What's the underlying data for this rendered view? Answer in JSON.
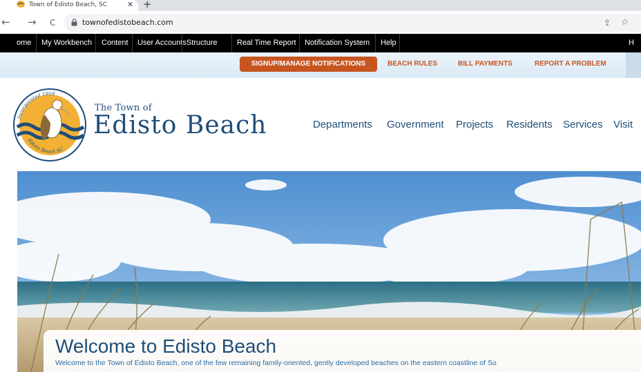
{
  "browser": {
    "tab_title": "Town of Edisto Beach, SC",
    "tab_close": "✕",
    "new_tab": "+",
    "url": "townofedistobeach.com",
    "nav": {
      "back": "←",
      "forward": "→",
      "reload": "C"
    },
    "icons": {
      "share": "⇪",
      "star": "☆"
    }
  },
  "admin_bar": {
    "items": [
      "ome",
      "My Workbench",
      "Content",
      "User Accounts",
      "Structure",
      "Real Time Report",
      "Notification System",
      "Help"
    ],
    "right_item": "H"
  },
  "utility_nav": {
    "signup": "SIGNUP/MANAGE NOTIFICATIONS",
    "links": [
      "BEACH RULES",
      "BILL PAYMENTS",
      "REPORT A PROBLEM"
    ],
    "accent_color": "#c75520"
  },
  "brand": {
    "line1": "The Town of",
    "line2": "Edisto Beach",
    "logo_ring_top": "Incorporated 1959",
    "logo_ring_bottom": "Edisto Beach SC",
    "color": "#1f4e79"
  },
  "main_nav": {
    "items": [
      "Departments",
      "Government",
      "Projects",
      "Residents",
      "Services",
      "Visit"
    ]
  },
  "welcome": {
    "title": "Welcome to Edisto Beach",
    "text": "Welcome to the Town of Edisto Beach, one of the few remaining family-oriented, gently developed beaches on the eastern coastline of So"
  }
}
